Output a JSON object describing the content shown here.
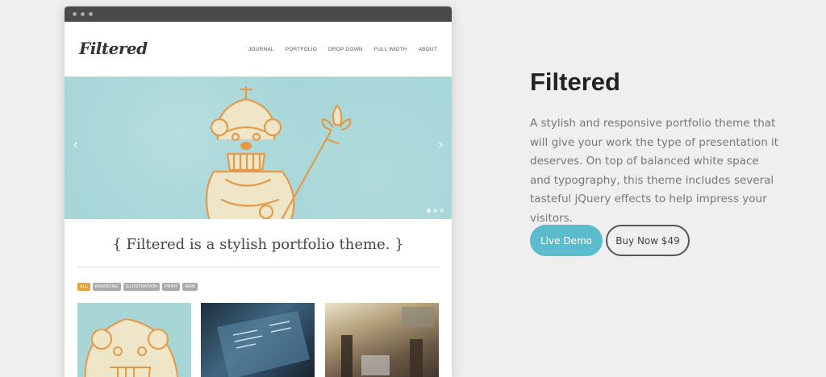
{
  "preview": {
    "logo": "Filtered",
    "nav": [
      "JOURNAL",
      "PORTFOLIO",
      "DROP DOWN",
      "FULL WIDTH",
      "ABOUT"
    ],
    "slider": {
      "prev_icon": "‹",
      "next_icon": "›",
      "dots": 3,
      "active_dot": 1
    },
    "tagline": "{ Filtered is a stylish portfolio theme. }",
    "filters": [
      "ALL",
      "BRANDING",
      "ILLUSTRATION",
      "PRINT",
      "WEB"
    ],
    "active_filter": "ALL"
  },
  "info": {
    "title": "Filtered",
    "description": "A stylish and responsive portfolio theme that will give your work the type of presentation it deserves. On top of balanced white space and typography, this theme includes several tasteful jQuery effects to help impress your visitors.",
    "demo_button": "Live Demo",
    "buy_button": "Buy Now $49"
  },
  "colors": {
    "accent": "#5bbccd",
    "hero_bg": "#a6d6d8",
    "filter_active": "#e8a23a",
    "browser_bar": "#4a4a4a"
  }
}
